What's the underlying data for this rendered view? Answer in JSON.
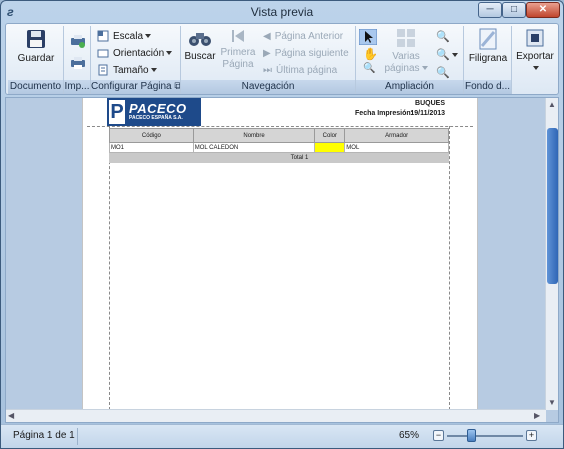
{
  "window": {
    "title": "Vista previa",
    "icon": "app-icon",
    "min_glyph": "─",
    "max_glyph": "□",
    "close_glyph": "✕"
  },
  "ribbon": {
    "documento": {
      "label": "Documento",
      "save_label": "Guardar"
    },
    "imprimir": {
      "label": "Imp..."
    },
    "configurar": {
      "label": "Configurar Página",
      "escala": "Escala",
      "orientacion": "Orientación",
      "tamano": "Tamaño"
    },
    "navegacion": {
      "label": "Navegación",
      "buscar": "Buscar",
      "primera": "Primera Página",
      "anterior": "Página Anterior",
      "siguiente": "Página siguiente",
      "ultima": "Última página"
    },
    "ampliacion": {
      "label": "Ampliación",
      "varias": "Varias páginas"
    },
    "fondo": {
      "label": "Fondo d...",
      "filigrana": "Filigrana"
    },
    "exportar": {
      "label": "Exportar"
    }
  },
  "report": {
    "logo_text": "PACECO",
    "logo_letter": "P",
    "logo_sub": "PACECO ESPAÑA S.A.",
    "title": "BUQUES",
    "date_label": "Fecha Impresión:",
    "date": "19/11/2013",
    "columns": [
      "Código",
      "Nombre",
      "Color",
      "Armador"
    ],
    "rows": [
      {
        "codigo": "MO1",
        "nombre": "MOL CALEDON",
        "color": "#ffff00",
        "armador": "MOL"
      }
    ],
    "total_label": "Total 1"
  },
  "status": {
    "page": "Página 1 de 1",
    "zoom": "65%",
    "zoom_value": 0.33,
    "zoom_minus": "−",
    "zoom_plus": "+"
  }
}
